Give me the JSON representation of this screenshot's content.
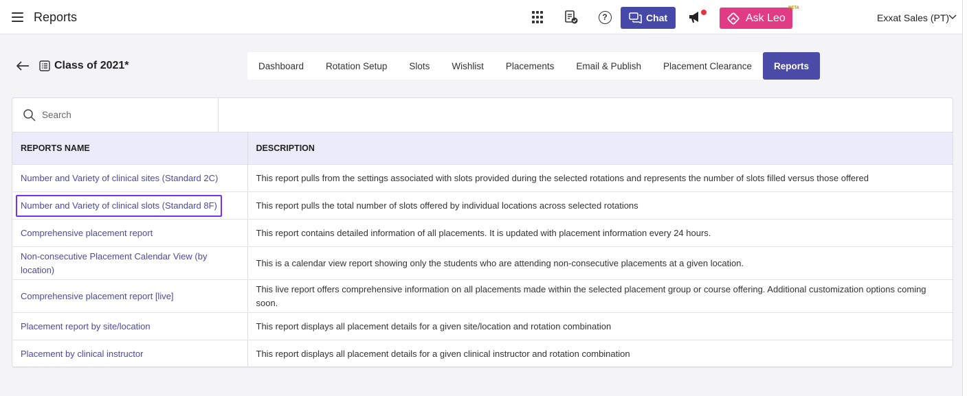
{
  "topbar": {
    "title": "Reports",
    "chat_label": "Chat",
    "ask_leo_label": "Ask Leo",
    "beta_label": "BETA",
    "user_name": "Exxat Sales (PT)",
    "icons": [
      "menu-icon",
      "apps-grid-icon",
      "clipboard-check-icon",
      "help-icon",
      "chat-icon",
      "megaphone-icon",
      "leo-icon",
      "chevron-down-icon"
    ],
    "colors": {
      "chat": "#4749a8",
      "ask_leo": "#e23b86",
      "notification_dot": "#e8333d"
    }
  },
  "subheader": {
    "class_title": "Class of 2021*",
    "tabs": [
      {
        "label": "Dashboard"
      },
      {
        "label": "Rotation Setup"
      },
      {
        "label": "Slots"
      },
      {
        "label": "Wishlist"
      },
      {
        "label": "Placements"
      },
      {
        "label": "Email & Publish"
      },
      {
        "label": "Placement Clearance"
      },
      {
        "label": "Reports"
      }
    ],
    "active_tab": "Reports",
    "active_color": "#4a4ca8"
  },
  "search": {
    "placeholder": "Search"
  },
  "table": {
    "headers": {
      "name": "REPORTS NAME",
      "description": "DESCRIPTION"
    },
    "rows": [
      {
        "name": "Number and Variety of clinical sites (Standard 2C)",
        "description": "This report pulls from the settings associated with slots provided during the selected rotations and represents the number of slots filled versus those offered"
      },
      {
        "name": "Number and Variety of clinical slots (Standard 8F)",
        "description": "This report pulls the total number of slots offered by individual locations across selected rotations"
      },
      {
        "name": "Comprehensive placement report",
        "description": "This report contains detailed information of all placements. It is updated with placement information every 24 hours."
      },
      {
        "name": "Non-consecutive Placement Calendar View (by location)",
        "description": "This is a calendar view report showing only the students who are attending non-consecutive placements at a given location."
      },
      {
        "name": "Comprehensive placement report [live]",
        "description": "This live report offers comprehensive information on all placements made within the selected placement group or course offering. Additional customization options coming soon."
      },
      {
        "name": "Placement report by site/location",
        "description": "This report displays all placement details for a given site/location and rotation combination"
      },
      {
        "name": "Placement by clinical instructor",
        "description": "This report displays all placement details for a given clinical instructor and rotation combination"
      }
    ],
    "highlighted_row_color": "#7b2ff0",
    "link_color": "#4b4aa8"
  }
}
